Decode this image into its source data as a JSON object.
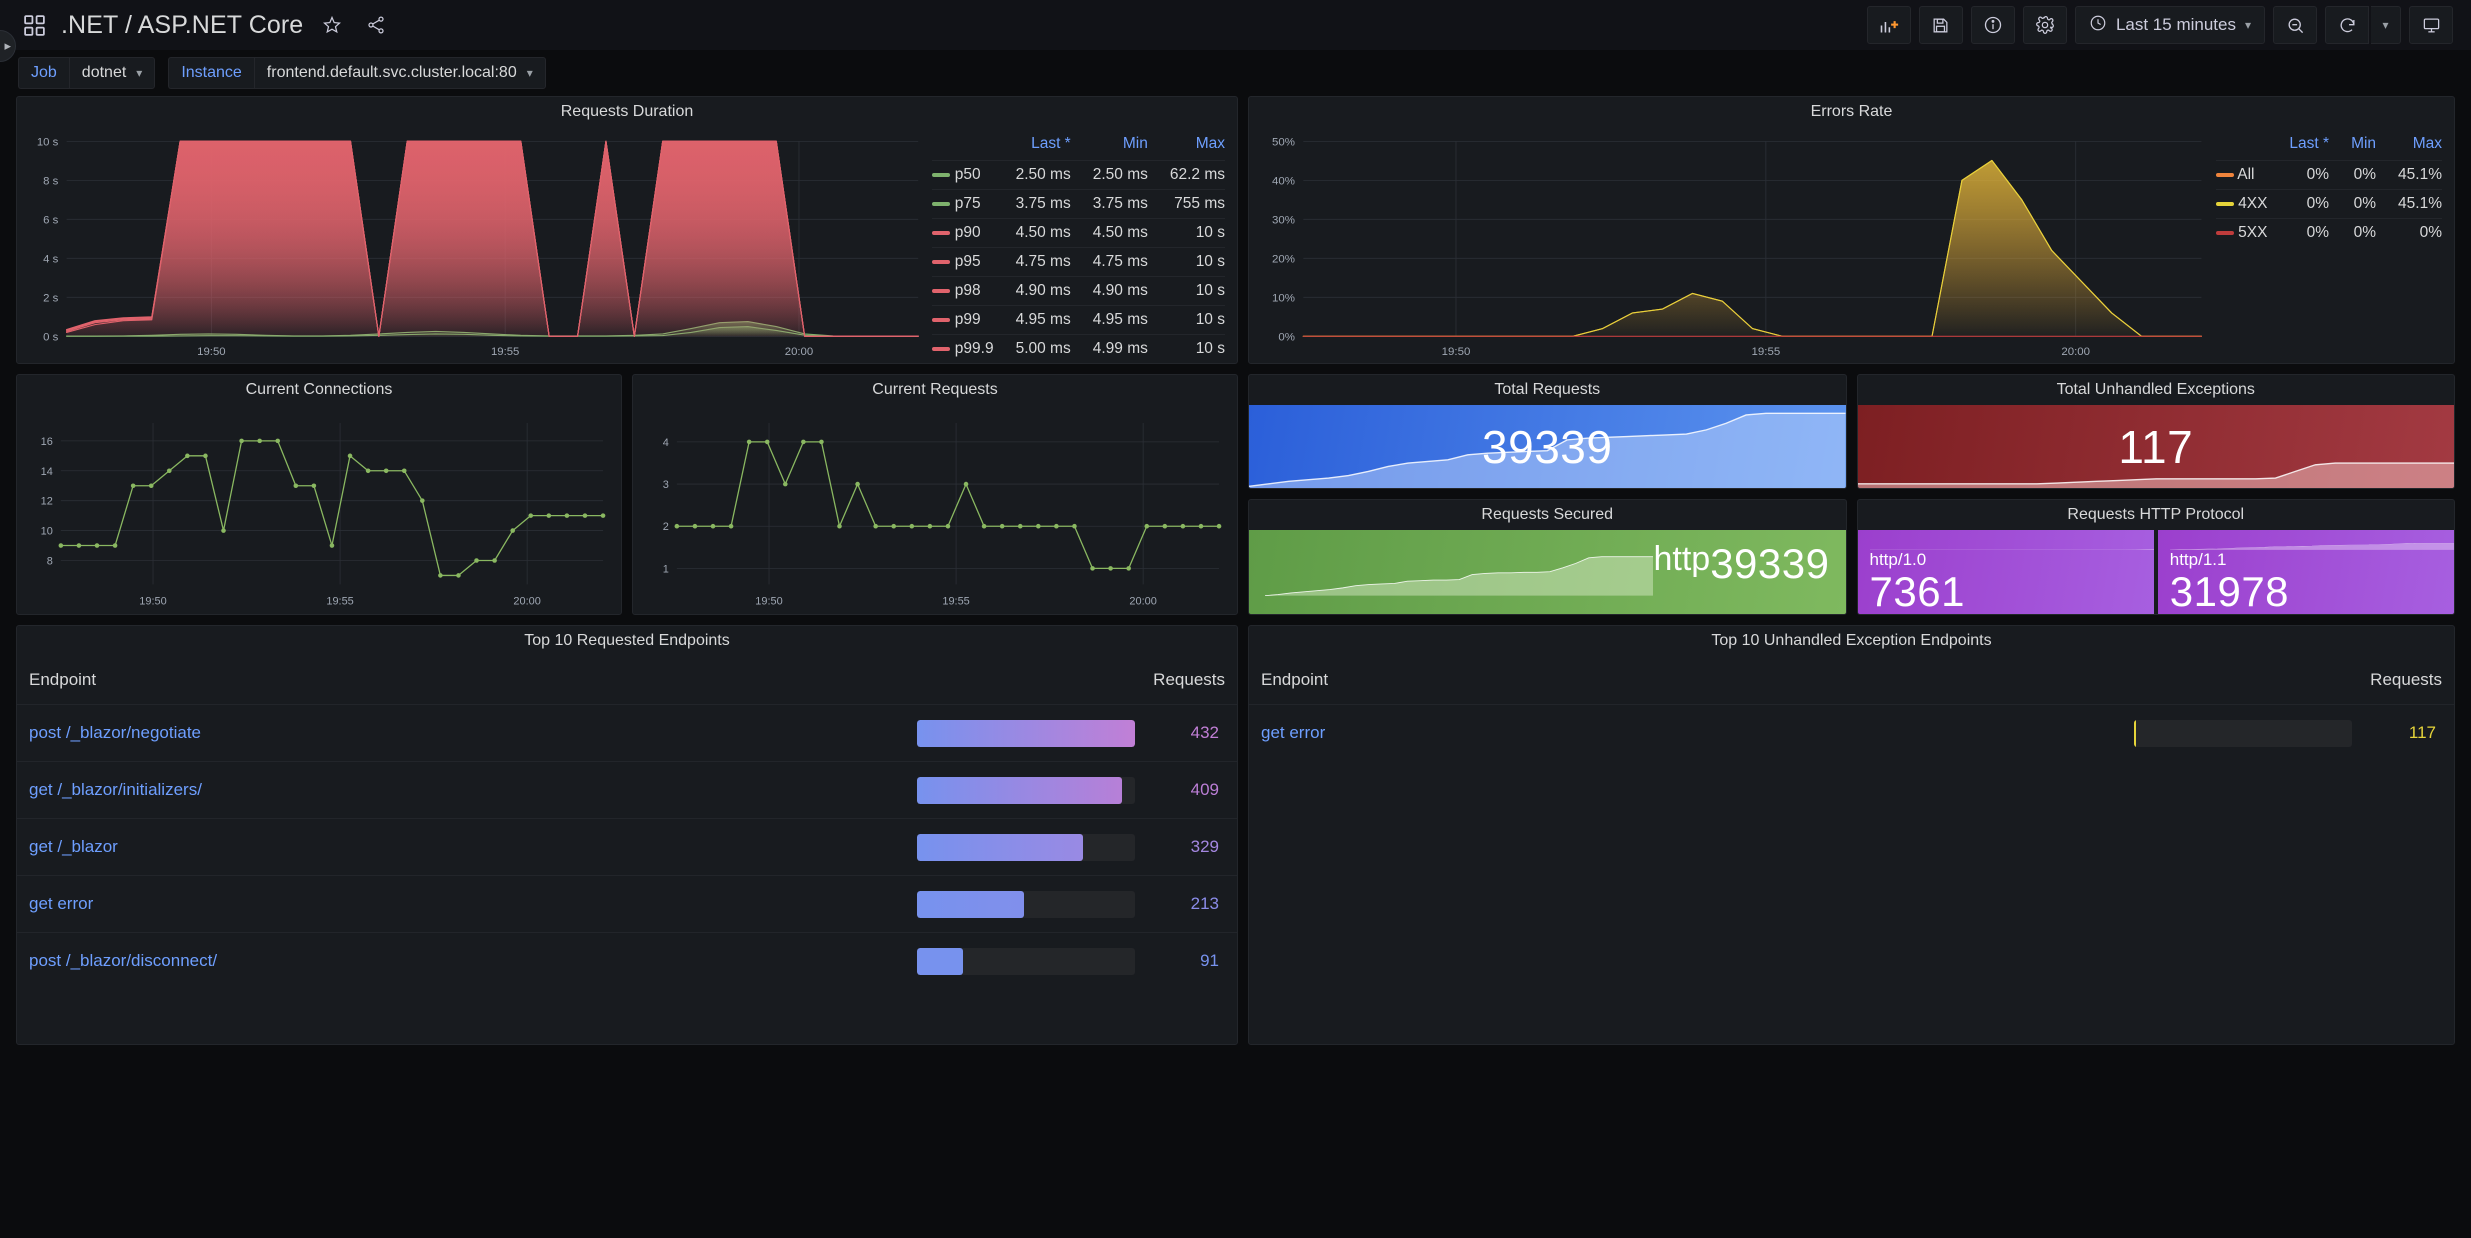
{
  "navbar": {
    "dashboard_icon": "grid-icon",
    "title": ".NET / ASP.NET Core",
    "star_icon": "star-icon",
    "share_icon": "share-icon",
    "buttons": [
      {
        "name": "add-panel-button",
        "icon": "add-panel-icon"
      },
      {
        "name": "save-dashboard-button",
        "icon": "save-icon"
      },
      {
        "name": "dashboard-info-button",
        "icon": "info-circle-icon"
      },
      {
        "name": "dashboard-settings-button",
        "icon": "gear-icon"
      }
    ],
    "time_picker": {
      "icon": "clock-icon",
      "label": "Last 15 minutes",
      "caret": "chevron-down-icon"
    },
    "zoom_out": {
      "name": "zoom-out-button",
      "icon": "zoom-out-icon"
    },
    "refresh": {
      "name": "refresh-button",
      "icon": "refresh-icon"
    },
    "refresh_interval_caret": "chevron-down-icon",
    "kiosk": {
      "name": "kiosk-mode-button",
      "icon": "tv-icon"
    }
  },
  "edge_tab": {
    "icon": "chevron-right-icon"
  },
  "variables": [
    {
      "label": "Job",
      "value": "dotnet",
      "caret": "chevron-down-icon"
    },
    {
      "label": "Instance",
      "value": "frontend.default.svc.cluster.local:80",
      "caret": "chevron-down-icon"
    }
  ],
  "panels": {
    "requests_duration": {
      "title": "Requests Duration",
      "legend": {
        "columns": [
          "Last *",
          "Min",
          "Max"
        ],
        "rows": [
          {
            "name": "p50",
            "color": "#7eb26d",
            "last": "2.50 ms",
            "min": "2.50 ms",
            "max": "62.2 ms"
          },
          {
            "name": "p75",
            "color": "#7eb26d",
            "last": "3.75 ms",
            "min": "3.75 ms",
            "max": "755 ms"
          },
          {
            "name": "p90",
            "color": "#e0636c",
            "last": "4.50 ms",
            "min": "4.50 ms",
            "max": "10 s"
          },
          {
            "name": "p95",
            "color": "#e0636c",
            "last": "4.75 ms",
            "min": "4.75 ms",
            "max": "10 s"
          },
          {
            "name": "p98",
            "color": "#e0636c",
            "last": "4.90 ms",
            "min": "4.90 ms",
            "max": "10 s"
          },
          {
            "name": "p99",
            "color": "#e0636c",
            "last": "4.95 ms",
            "min": "4.95 ms",
            "max": "10 s"
          },
          {
            "name": "p99.9",
            "color": "#e0636c",
            "last": "5.00 ms",
            "min": "4.99 ms",
            "max": "10 s"
          }
        ]
      }
    },
    "errors_rate": {
      "title": "Errors Rate",
      "legend": {
        "columns": [
          "Last *",
          "Min",
          "Max"
        ],
        "rows": [
          {
            "name": "All",
            "color": "#ef843c",
            "last": "0%",
            "min": "0%",
            "max": "45.1%"
          },
          {
            "name": "4XX",
            "color": "#e5d43a",
            "last": "0%",
            "min": "0%",
            "max": "45.1%"
          },
          {
            "name": "5XX",
            "color": "#bf3c3c",
            "last": "0%",
            "min": "0%",
            "max": "0%"
          }
        ]
      }
    },
    "current_connections": {
      "title": "Current Connections"
    },
    "current_requests": {
      "title": "Current Requests"
    },
    "total_requests": {
      "title": "Total Requests",
      "value": "39339",
      "color": "#3871dc"
    },
    "total_unhandled_exceptions": {
      "title": "Total Unhandled Exceptions",
      "value": "117",
      "color": "#8a2326"
    },
    "requests_secured": {
      "title": "Requests Secured",
      "name": "http",
      "value": "39339",
      "color": "#6aa84f"
    },
    "requests_http_protocol": {
      "title": "Requests HTTP Protocol",
      "items": [
        {
          "name": "http/1.0",
          "value": "7361",
          "color": "#a253d4"
        },
        {
          "name": "http/1.1",
          "value": "31978",
          "color": "#a253d4"
        }
      ]
    },
    "top_requested_endpoints": {
      "title": "Top 10 Requested Endpoints",
      "columns": [
        "Endpoint",
        "Requests"
      ],
      "rows": [
        {
          "endpoint": "post /_blazor/negotiate",
          "requests": "432",
          "pct": 100,
          "color": "#c17fd6"
        },
        {
          "endpoint": "get /_blazor/initializers/",
          "requests": "409",
          "pct": 94,
          "color": "#bb7ed6"
        },
        {
          "endpoint": "get /_blazor",
          "requests": "329",
          "pct": 76,
          "color": "#a487e0"
        },
        {
          "endpoint": "get error",
          "requests": "213",
          "pct": 49,
          "color": "#8b8ce9"
        },
        {
          "endpoint": "post /_blazor/disconnect/",
          "requests": "91",
          "pct": 21,
          "color": "#7792ee"
        }
      ]
    },
    "top_unhandled_exception_endpoints": {
      "title": "Top 10 Unhandled Exception Endpoints",
      "columns": [
        "Endpoint",
        "Requests"
      ],
      "rows": [
        {
          "endpoint": "get error",
          "requests": "117",
          "pct": 0,
          "color": "#e5d43a"
        }
      ]
    }
  },
  "chart_data": [
    {
      "type": "area",
      "panel": "Requests Duration",
      "title": "Requests Duration",
      "xlabel": "",
      "ylabel": "",
      "xtick_labels": [
        "19:50",
        "19:55",
        "20:00"
      ],
      "ytick_labels": [
        "0 s",
        "2 s",
        "4 s",
        "6 s",
        "8 s",
        "10 s"
      ],
      "ylim": [
        0,
        10
      ],
      "yunit": "s",
      "grid": true,
      "legend_position": "right-table",
      "series": [
        {
          "name": "p50",
          "color": "#7eb26d",
          "values": [
            0.005,
            0.005,
            0.005,
            0.01,
            0.02,
            0.03,
            0.03,
            0.02,
            0.01,
            0.01,
            0.02,
            0.05,
            0.09,
            0.12,
            0.1,
            0.05,
            0.02,
            0.01,
            0.01,
            0.01,
            0.02,
            0.04,
            0.2,
            0.45,
            0.5,
            0.3,
            0.06,
            0.01,
            0.0025,
            0.0025,
            0.0025
          ]
        },
        {
          "name": "p75",
          "color": "#7eb26d",
          "values": [
            0.01,
            0.01,
            0.02,
            0.05,
            0.1,
            0.12,
            0.1,
            0.05,
            0.02,
            0.02,
            0.05,
            0.12,
            0.2,
            0.25,
            0.2,
            0.12,
            0.05,
            0.02,
            0.02,
            0.02,
            0.05,
            0.12,
            0.4,
            0.7,
            0.755,
            0.5,
            0.12,
            0.02,
            0.00375,
            0.00375,
            0.00375
          ]
        },
        {
          "name": "p90",
          "color": "#e0636c",
          "values": [
            0.2,
            0.6,
            0.8,
            0.85,
            10,
            10,
            10,
            10,
            10,
            10,
            10,
            0,
            10,
            10,
            10,
            10,
            10,
            0,
            0,
            10,
            0,
            10,
            10,
            10,
            10,
            10,
            0,
            0,
            0.0045,
            0.0045,
            0.0045
          ]
        },
        {
          "name": "p95",
          "color": "#e0636c",
          "values": [
            0.25,
            0.7,
            0.85,
            0.9,
            10,
            10,
            10,
            10,
            10,
            10,
            10,
            0,
            10,
            10,
            10,
            10,
            10,
            0,
            0,
            10,
            0,
            10,
            10,
            10,
            10,
            10,
            0,
            0,
            0.00475,
            0.00475,
            0.00475
          ]
        },
        {
          "name": "p98",
          "color": "#e0636c",
          "values": [
            0.3,
            0.75,
            0.9,
            0.95,
            10,
            10,
            10,
            10,
            10,
            10,
            10,
            0,
            10,
            10,
            10,
            10,
            10,
            0,
            0,
            10,
            0,
            10,
            10,
            10,
            10,
            10,
            0,
            0,
            0.0049,
            0.0049,
            0.0049
          ]
        },
        {
          "name": "p99",
          "color": "#e0636c",
          "values": [
            0.32,
            0.78,
            0.92,
            0.97,
            10,
            10,
            10,
            10,
            10,
            10,
            10,
            0,
            10,
            10,
            10,
            10,
            10,
            0,
            0,
            10,
            0,
            10,
            10,
            10,
            10,
            10,
            0,
            0,
            0.00495,
            0.00495,
            0.00495
          ]
        },
        {
          "name": "p99.9",
          "color": "#e0636c",
          "values": [
            0.35,
            0.8,
            0.95,
            1.0,
            10,
            10,
            10,
            10,
            10,
            10,
            10,
            0,
            10,
            10,
            10,
            10,
            10,
            0,
            0,
            10,
            0,
            10,
            10,
            10,
            10,
            10,
            0,
            0,
            0.005,
            0.005,
            0.005
          ]
        }
      ]
    },
    {
      "type": "area",
      "panel": "Errors Rate",
      "title": "Errors Rate",
      "xlabel": "",
      "ylabel": "",
      "xtick_labels": [
        "19:50",
        "19:55",
        "20:00"
      ],
      "ytick_labels": [
        "0%",
        "10%",
        "20%",
        "30%",
        "40%",
        "50%"
      ],
      "ylim": [
        0,
        50
      ],
      "yunit": "%",
      "grid": true,
      "legend_position": "right-table",
      "series": [
        {
          "name": "All",
          "color": "#ef843c",
          "values": [
            0,
            0,
            0,
            0,
            0,
            0,
            0,
            0,
            0,
            0,
            2,
            6,
            7,
            11,
            9,
            2,
            0,
            0,
            0,
            0,
            0,
            0,
            40,
            45.1,
            35,
            22,
            14,
            6,
            0,
            0,
            0
          ]
        },
        {
          "name": "4XX",
          "color": "#e5d43a",
          "values": [
            0,
            0,
            0,
            0,
            0,
            0,
            0,
            0,
            0,
            0,
            2,
            6,
            7,
            11,
            9,
            2,
            0,
            0,
            0,
            0,
            0,
            0,
            40,
            45.1,
            35,
            22,
            14,
            6,
            0,
            0,
            0
          ]
        },
        {
          "name": "5XX",
          "color": "#bf3c3c",
          "values": [
            0,
            0,
            0,
            0,
            0,
            0,
            0,
            0,
            0,
            0,
            0,
            0,
            0,
            0,
            0,
            0,
            0,
            0,
            0,
            0,
            0,
            0,
            0,
            0,
            0,
            0,
            0,
            0,
            0,
            0,
            0
          ]
        }
      ]
    },
    {
      "type": "line",
      "panel": "Current Connections",
      "title": "Current Connections",
      "xlabel": "",
      "ylabel": "",
      "xtick_labels": [
        "19:50",
        "19:55",
        "20:00"
      ],
      "ytick_labels": [
        "8",
        "10",
        "12",
        "14",
        "16"
      ],
      "ylim": [
        6.4,
        17.2
      ],
      "grid": true,
      "points": true,
      "series": [
        {
          "name": "connections",
          "color": "#8ab861",
          "values": [
            9,
            9,
            9,
            9,
            13,
            13,
            14,
            15,
            15,
            10,
            16,
            16,
            16,
            13,
            13,
            9,
            15,
            14,
            14,
            14,
            12,
            7,
            7,
            8,
            8,
            10,
            11,
            11,
            11,
            11,
            11
          ]
        }
      ]
    },
    {
      "type": "line",
      "panel": "Current Requests",
      "title": "Current Requests",
      "xlabel": "",
      "ylabel": "",
      "xtick_labels": [
        "19:50",
        "19:55",
        "20:00"
      ],
      "ytick_labels": [
        "1",
        "2",
        "3",
        "4"
      ],
      "ylim": [
        0.62,
        4.45
      ],
      "grid": true,
      "points": true,
      "series": [
        {
          "name": "requests",
          "color": "#8ab861",
          "values": [
            2,
            2,
            2,
            2,
            4,
            4,
            3,
            4,
            4,
            2,
            3,
            2,
            2,
            2,
            2,
            2,
            3,
            2,
            2,
            2,
            2,
            2,
            2,
            1,
            1,
            1,
            2,
            2,
            2,
            2,
            2
          ]
        }
      ]
    },
    {
      "type": "area",
      "panel": "Total Requests",
      "title": "Total Requests",
      "sparkline": true,
      "series": [
        {
          "name": "total requests",
          "values": [
            0.02,
            0.05,
            0.08,
            0.1,
            0.12,
            0.15,
            0.2,
            0.26,
            0.3,
            0.32,
            0.34,
            0.4,
            0.42,
            0.43,
            0.44,
            0.45,
            0.58,
            0.6,
            0.61,
            0.62,
            0.63,
            0.64,
            0.65,
            0.7,
            0.78,
            0.88,
            0.9,
            0.9,
            0.9,
            0.9,
            0.9
          ]
        }
      ]
    },
    {
      "type": "area",
      "panel": "Total Unhandled Exceptions",
      "title": "Total Unhandled Exceptions",
      "sparkline": true,
      "series": [
        {
          "name": "exceptions",
          "values": [
            0.05,
            0.05,
            0.05,
            0.05,
            0.05,
            0.05,
            0.05,
            0.05,
            0.05,
            0.05,
            0.06,
            0.07,
            0.08,
            0.09,
            0.1,
            0.11,
            0.11,
            0.11,
            0.11,
            0.11,
            0.11,
            0.12,
            0.2,
            0.28,
            0.3,
            0.3,
            0.3,
            0.3,
            0.3,
            0.3,
            0.3
          ]
        }
      ]
    },
    {
      "type": "area",
      "panel": "Requests Secured",
      "title": "Requests Secured",
      "sparkline": true,
      "series": [
        {
          "name": "http",
          "values": [
            0.0,
            0.02,
            0.05,
            0.07,
            0.09,
            0.11,
            0.14,
            0.18,
            0.2,
            0.21,
            0.22,
            0.26,
            0.27,
            0.28,
            0.28,
            0.29,
            0.38,
            0.4,
            0.41,
            0.41,
            0.42,
            0.42,
            0.43,
            0.5,
            0.58,
            0.68,
            0.7,
            0.7,
            0.7,
            0.7,
            0.7
          ]
        }
      ]
    },
    {
      "type": "area",
      "panel": "Requests HTTP Protocol",
      "title": "Requests HTTP Protocol",
      "sparkline": true,
      "series": [
        {
          "name": "http/1.0",
          "values": [
            0,
            0,
            0,
            0,
            0,
            0,
            0,
            0,
            0,
            0,
            0,
            0,
            0,
            0,
            0,
            0,
            0,
            0,
            0,
            0,
            0,
            0,
            0,
            0,
            0,
            0,
            0,
            0,
            0.02,
            0.03,
            0.04
          ]
        },
        {
          "name": "http/1.1",
          "values": [
            0.02,
            0.04,
            0.06,
            0.08,
            0.1,
            0.12,
            0.16,
            0.2,
            0.24,
            0.26,
            0.28,
            0.32,
            0.34,
            0.36,
            0.38,
            0.4,
            0.46,
            0.48,
            0.49,
            0.5,
            0.51,
            0.52,
            0.54,
            0.58,
            0.62,
            0.66,
            0.68,
            0.68,
            0.68,
            0.68,
            0.68
          ]
        }
      ]
    },
    {
      "type": "bar",
      "panel": "Top 10 Requested Endpoints",
      "title": "Top 10 Requested Endpoints",
      "xlabel": "Requests",
      "ylabel": "Endpoint",
      "categories": [
        "post /_blazor/negotiate",
        "get /_blazor/initializers/",
        "get /_blazor",
        "get error",
        "post /_blazor/disconnect/"
      ],
      "values": [
        432,
        409,
        329,
        213,
        91
      ]
    },
    {
      "type": "bar",
      "panel": "Top 10 Unhandled Exception Endpoints",
      "title": "Top 10 Unhandled Exception Endpoints",
      "xlabel": "Requests",
      "ylabel": "Endpoint",
      "categories": [
        "get error"
      ],
      "values": [
        117
      ]
    }
  ]
}
